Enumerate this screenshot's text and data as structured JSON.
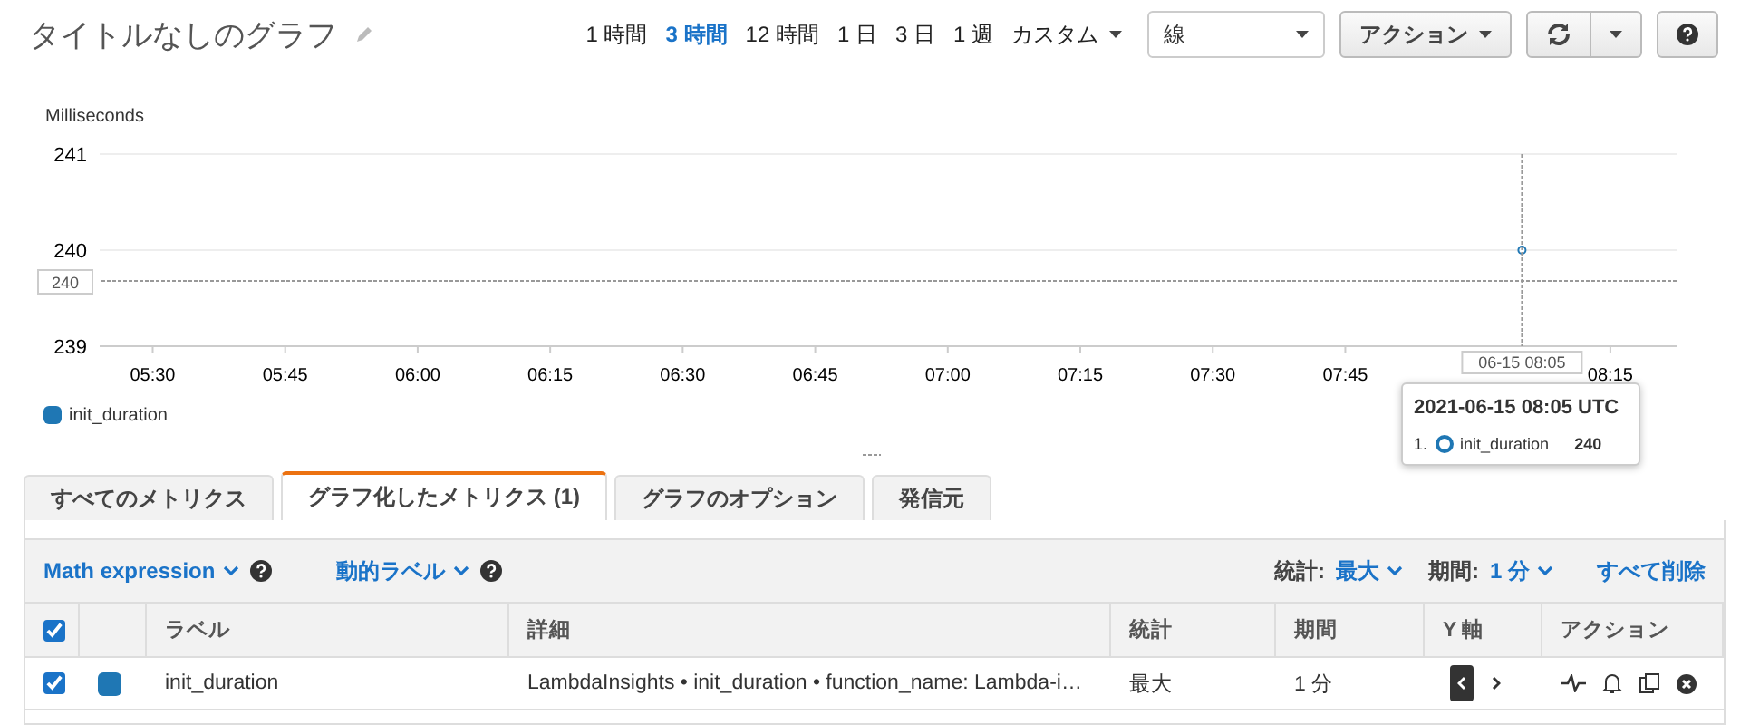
{
  "header": {
    "title": "タイトルなしのグラフ",
    "ranges": [
      {
        "label": "1 時間",
        "selected": false
      },
      {
        "label": "3 時間",
        "selected": true
      },
      {
        "label": "12 時間",
        "selected": false
      },
      {
        "label": "1 日",
        "selected": false
      },
      {
        "label": "3 日",
        "selected": false
      },
      {
        "label": "1 週",
        "selected": false
      }
    ],
    "custom": "カスタム",
    "chart_type": "線",
    "actions": "アクション"
  },
  "graph": {
    "chart_data": {
      "type": "line",
      "ylabel": "Milliseconds",
      "xlim": [
        324,
        502.5
      ],
      "ylim": [
        239,
        241
      ],
      "yticks": [
        239,
        240,
        241
      ],
      "xticks": [
        {
          "value": 330,
          "label": "05:30"
        },
        {
          "value": 345,
          "label": "05:45"
        },
        {
          "value": 360,
          "label": "06:00"
        },
        {
          "value": 375,
          "label": "06:15"
        },
        {
          "value": 390,
          "label": "06:30"
        },
        {
          "value": 405,
          "label": "06:45"
        },
        {
          "value": 420,
          "label": "07:00"
        },
        {
          "value": 435,
          "label": "07:15"
        },
        {
          "value": 450,
          "label": "07:30"
        },
        {
          "value": 465,
          "label": "07:45"
        },
        {
          "value": 495,
          "label": "08:15"
        }
      ],
      "x": [
        485
      ],
      "series": [
        {
          "name": "init_duration",
          "color": "#1f77b4",
          "marker": "o",
          "values": [
            240
          ]
        }
      ],
      "stacked": false
    },
    "crosshair": {
      "y_label": "240",
      "x_label": "06-15 08:05"
    },
    "tooltip": {
      "title": "2021-06-15 08:05 UTC",
      "rows": [
        {
          "index": "1.",
          "name": "init_duration",
          "value": "240",
          "color": "#1f77b4"
        }
      ]
    }
  },
  "tabs": [
    {
      "label": "すべてのメトリクス",
      "selected": false
    },
    {
      "label": "グラフ化したメトリクス (1)",
      "selected": true
    },
    {
      "label": "グラフのオプション",
      "selected": false
    },
    {
      "label": "発信元",
      "selected": false
    }
  ],
  "toolbar": {
    "math": "Math expression",
    "dynamic": "動的ラベル",
    "stat_label": "統計:",
    "stat_value": "最大",
    "period_label": "期間:",
    "period_value": "1 分",
    "delete_all": "すべて削除"
  },
  "table": {
    "all_checked": true,
    "columns": [
      "ラベル",
      "詳細",
      "統計",
      "期間",
      "Y 軸",
      "アクション"
    ],
    "rows": [
      {
        "checked": true,
        "color": "#1f77b4",
        "label": "init_duration",
        "detail": "LambdaInsights • init_duration • function_name: Lambda-i…",
        "stat": "最大",
        "period": "1 分",
        "y_axis_left": true
      }
    ]
  }
}
